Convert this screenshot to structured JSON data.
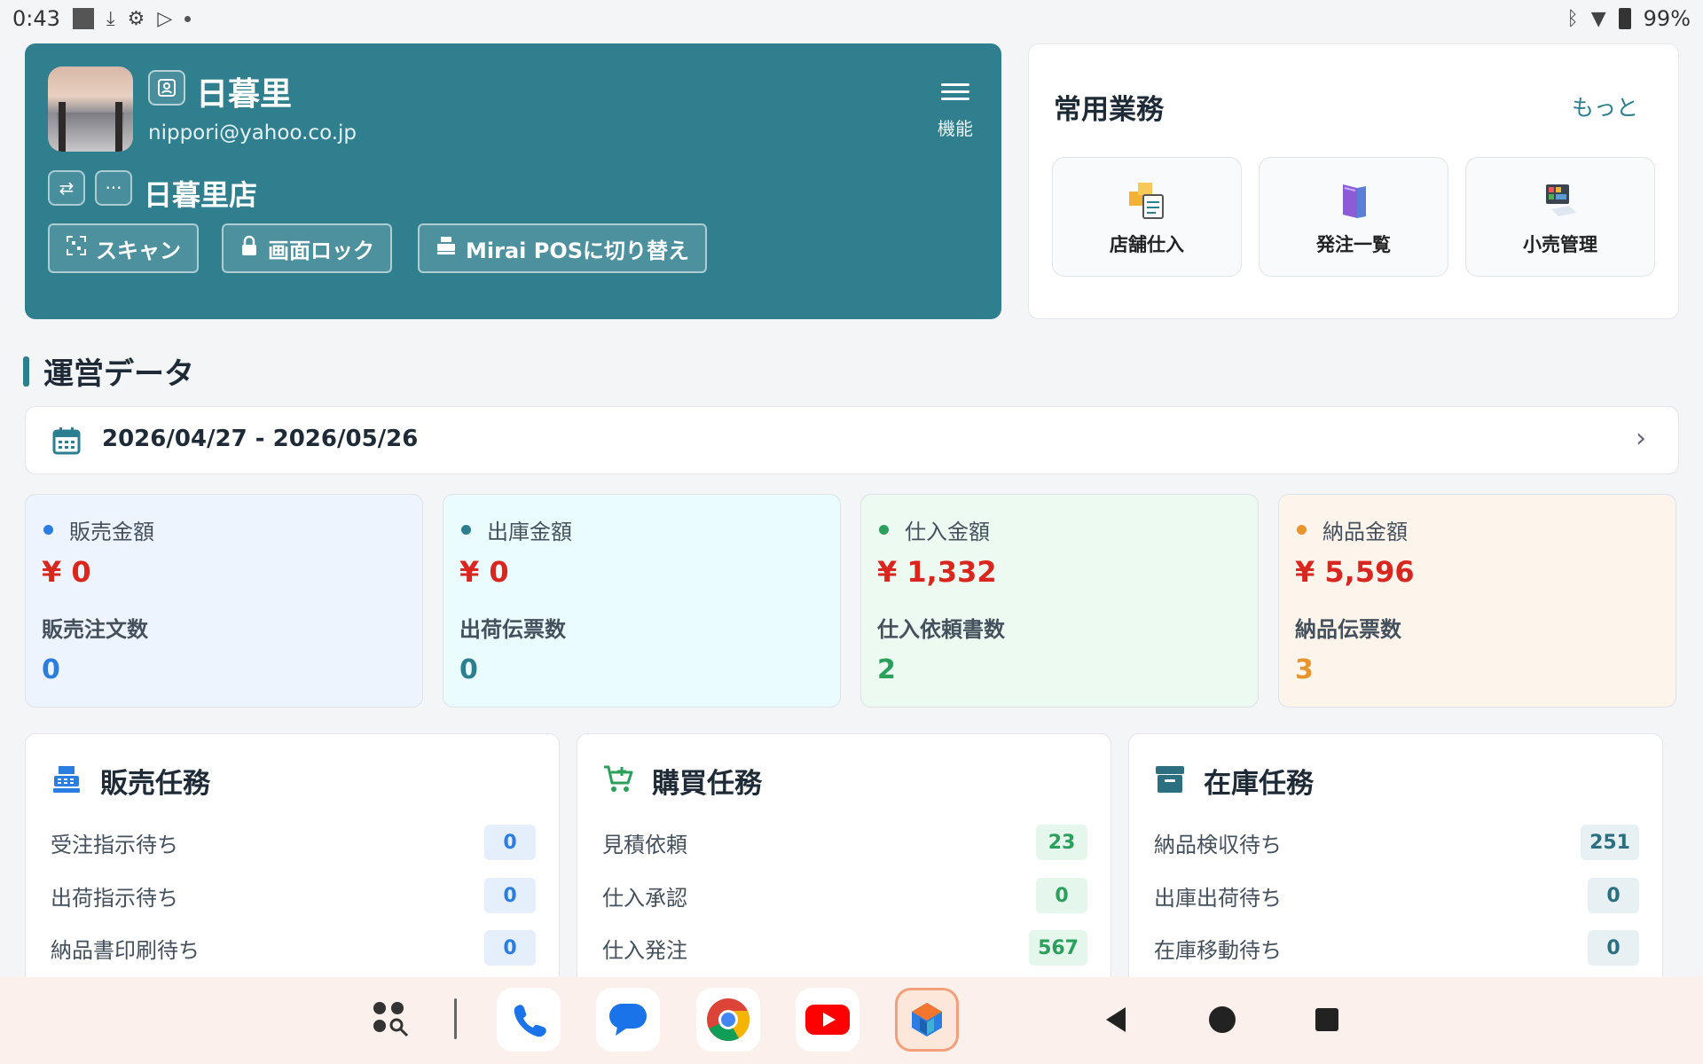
{
  "status_bar": {
    "time": "0:43",
    "battery": "99%"
  },
  "profile": {
    "name": "日暮里",
    "email": "nippori@yahoo.co.jp",
    "menu_label": "機能",
    "store": "日暮里店",
    "actions": {
      "scan": "スキャン",
      "lock": "画面ロック",
      "switch_pos": "Mirai POSに切り替え"
    }
  },
  "common_tasks": {
    "title": "常用業務",
    "more": "もっと",
    "items": [
      {
        "label": "店舗仕入",
        "icon": "box-stack-icon"
      },
      {
        "label": "発注一覧",
        "icon": "book-icon"
      },
      {
        "label": "小売管理",
        "icon": "monitor-icon"
      }
    ]
  },
  "operations": {
    "title": "運営データ",
    "date_range": "2026/04/27 - 2026/05/26"
  },
  "stats": [
    {
      "label": "販売金額",
      "amount": "¥ 0",
      "sub_label": "販売注文数",
      "count": "0",
      "color": "#2a7de1",
      "bg": "#eef4fd"
    },
    {
      "label": "出庫金額",
      "amount": "¥ 0",
      "sub_label": "出荷伝票数",
      "count": "0",
      "color": "#2b7f90",
      "bg": "#eafcfd"
    },
    {
      "label": "仕入金額",
      "amount": "¥ 1,332",
      "sub_label": "仕入依頼書数",
      "count": "2",
      "color": "#2aa05c",
      "bg": "#edfaf2"
    },
    {
      "label": "納品金額",
      "amount": "¥ 5,596",
      "sub_label": "納品伝票数",
      "count": "3",
      "color": "#e8952e",
      "bg": "#fdf5ec"
    }
  ],
  "tasks": [
    {
      "title": "販売任務",
      "icon": "cash-register-icon",
      "color": "#2a7de1",
      "badge_bg": "#e5effc",
      "rows": [
        {
          "label": "受注指示待ち",
          "value": "0"
        },
        {
          "label": "出荷指示待ち",
          "value": "0"
        },
        {
          "label": "納品書印刷待ち",
          "value": "0"
        }
      ]
    },
    {
      "title": "購買任務",
      "icon": "cart-icon",
      "color": "#2aa05c",
      "badge_bg": "#e5f6ec",
      "rows": [
        {
          "label": "見積依頼",
          "value": "23"
        },
        {
          "label": "仕入承認",
          "value": "0"
        },
        {
          "label": "仕入発注",
          "value": "567"
        }
      ]
    },
    {
      "title": "在庫任務",
      "icon": "archive-icon",
      "color": "#2b6f80",
      "badge_bg": "#e7f1f3",
      "rows": [
        {
          "label": "納品検収待ち",
          "value": "251"
        },
        {
          "label": "出庫出荷待ち",
          "value": "0"
        },
        {
          "label": "在庫移動待ち",
          "value": "0"
        }
      ]
    }
  ]
}
